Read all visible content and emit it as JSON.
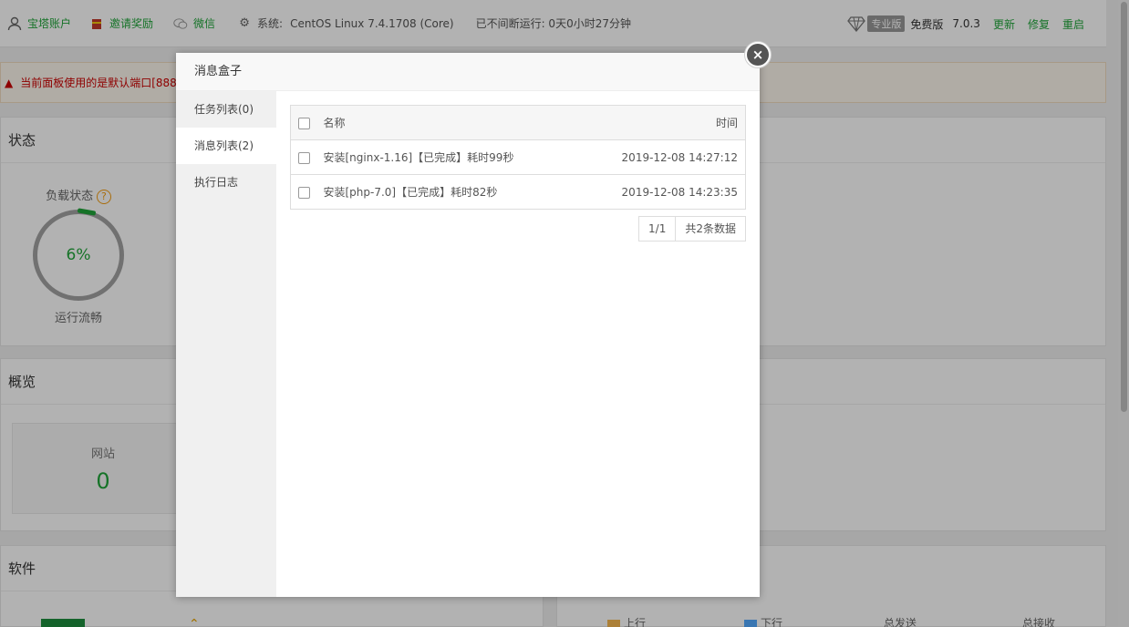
{
  "topbar": {
    "account": "宝塔账户",
    "invite": "邀请奖励",
    "wechat": "微信",
    "system_label": "系统:",
    "system_value": "CentOS Linux 7.4.1708 (Core)",
    "uptime": "已不间断运行: 0天0小时27分钟",
    "pro_badge": "专业版",
    "edition": "免费版",
    "version": "7.0.3",
    "update": "更新",
    "repair": "修复",
    "restart": "重启"
  },
  "warning": {
    "text": "当前面板使用的是默认端口[888"
  },
  "status_panel": {
    "title": "状态",
    "load_label": "负载状态",
    "help": "?",
    "load_value": "6%",
    "load_state": "运行流畅"
  },
  "overview_panel": {
    "title": "概览",
    "site_label": "网站",
    "site_count": "0"
  },
  "software_panel": {
    "title": "软件"
  },
  "traffic": {
    "up": "上行",
    "down": "下行",
    "total_sent": "总发送",
    "total_recv": "总接收"
  },
  "modal": {
    "title": "消息盒子",
    "close": "×",
    "tabs": [
      {
        "label": "任务列表(0)"
      },
      {
        "label": "消息列表(2)"
      },
      {
        "label": "执行日志"
      }
    ],
    "table": {
      "col_name": "名称",
      "col_time": "时间",
      "rows": [
        {
          "name": "安装[nginx-1.16]【已完成】耗时99秒",
          "time": "2019-12-08 14:27:12"
        },
        {
          "name": "安装[php-7.0]【已完成】耗时82秒",
          "time": "2019-12-08 14:23:35"
        }
      ]
    },
    "pager": {
      "page": "1/1",
      "total": "共2条数据"
    }
  }
}
